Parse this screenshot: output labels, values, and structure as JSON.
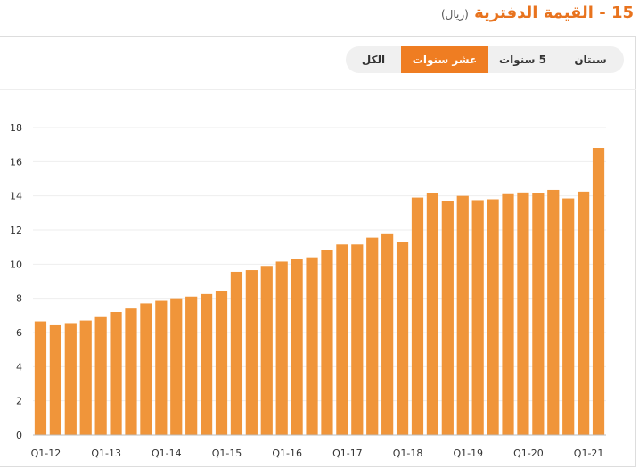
{
  "header": {
    "title": "15 - القيمة الدفترية",
    "unit": "(ريال)"
  },
  "tabs": [
    {
      "label": "سنتان",
      "active": false
    },
    {
      "label": "5 سنوات",
      "active": false
    },
    {
      "label": "عشر سنوات",
      "active": true
    },
    {
      "label": "الكل",
      "active": false
    }
  ],
  "colors": {
    "accent": "#ef7d22",
    "bar": "#f0953a",
    "title": "#e8731e"
  },
  "chart_data": {
    "type": "bar",
    "title": "",
    "xlabel": "",
    "ylabel": "",
    "ylim": [
      0,
      18
    ],
    "y_ticks": [
      0,
      2,
      4,
      6,
      8,
      10,
      12,
      14,
      16,
      18
    ],
    "grid": true,
    "categories": [
      "Q1-12",
      "Q2-12",
      "Q3-12",
      "Q4-12",
      "Q1-13",
      "Q2-13",
      "Q3-13",
      "Q4-13",
      "Q1-14",
      "Q2-14",
      "Q3-14",
      "Q4-14",
      "Q1-15",
      "Q2-15",
      "Q3-15",
      "Q4-15",
      "Q1-16",
      "Q2-16",
      "Q3-16",
      "Q4-16",
      "Q1-17",
      "Q2-17",
      "Q3-17",
      "Q4-17",
      "Q1-18",
      "Q2-18",
      "Q3-18",
      "Q4-18",
      "Q1-19",
      "Q2-19",
      "Q3-19",
      "Q4-19",
      "Q1-20",
      "Q2-20",
      "Q3-20",
      "Q4-20",
      "Q1-21",
      "Q2-21"
    ],
    "x_tick_labels": [
      "Q1-12",
      "Q1-13",
      "Q1-14",
      "Q1-15",
      "Q1-16",
      "Q1-17",
      "Q1-18",
      "Q1-19",
      "Q1-20",
      "Q1-21"
    ],
    "values": [
      6.65,
      6.42,
      6.55,
      6.7,
      6.9,
      7.2,
      7.4,
      7.7,
      7.85,
      8.0,
      8.1,
      8.25,
      8.45,
      9.55,
      9.65,
      9.9,
      10.15,
      10.3,
      10.4,
      10.85,
      11.15,
      11.15,
      11.55,
      11.8,
      11.3,
      13.9,
      14.15,
      13.7,
      14.0,
      13.75,
      13.8,
      14.1,
      14.2,
      14.15,
      14.35,
      13.85,
      14.25,
      16.8
    ]
  }
}
